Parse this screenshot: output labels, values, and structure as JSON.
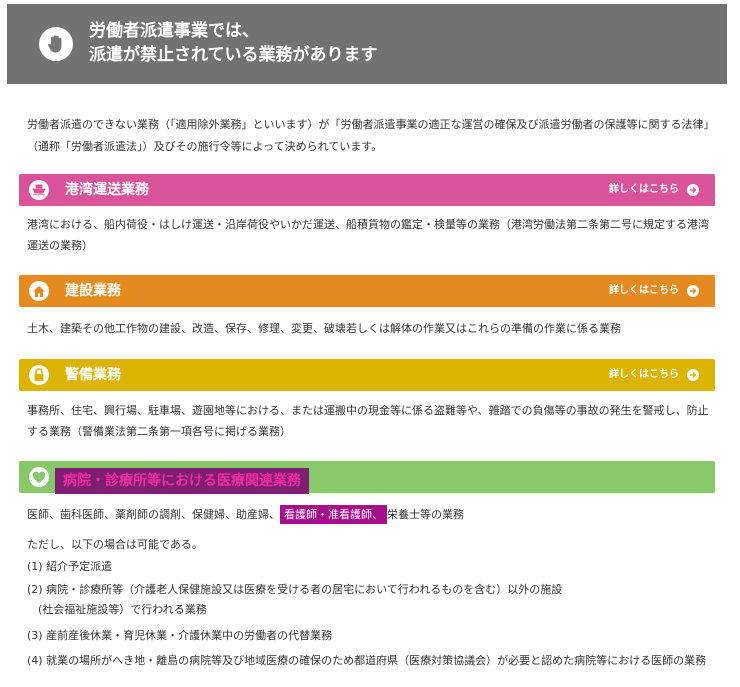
{
  "header": {
    "title_line1": "労働者派遣事業では、",
    "title_line2": "派遣が禁止されている業務があります"
  },
  "intro": "労働者派遣のできない業務（「適用除外業務」といいます）が「労働者派遣事業の適正な運営の確保及び派遣労働者の保護等に関する法律」（通称「労働者派遣法」）及びその施行令等によって決められています。",
  "sections": [
    {
      "title": "港湾運送業務",
      "link": "詳しくはこちら",
      "color": "#d9539b",
      "desc": "港湾における、船内荷役・はしけ運送・沿岸荷役やいかだ運送、船積貨物の鑑定・検量等の業務（港湾労働法第二条第二号に規定する港湾運送の業務）"
    },
    {
      "title": "建設業務",
      "link": "詳しくはこちら",
      "color": "#e58a1f",
      "desc": "土木、建築その他工作物の建設、改造、保存、修理、変更、破壊若しくは解体の作業又はこれらの準備の作業に係る業務"
    },
    {
      "title": "警備業務",
      "link": "詳しくはこちら",
      "color": "#dcb300",
      "desc": "事務所、住宅、興行場、駐車場、遊園地等における、または運搬中の現金等に係る盗難等や、雑踏での負傷等の事故の発生を警戒し、防止する業務（警備業法第二条第一項各号に掲げる業務）"
    },
    {
      "title": "病院・診療所等における医療関連業務",
      "color": "#86c86a",
      "desc_before": "医師、歯科医師、薬剤師の調剤、保健婦、助産婦、",
      "desc_highlight": "看護師・准看護師、",
      "desc_after": "栄養士等の業務"
    }
  ],
  "exceptions": {
    "lead": "ただし、以下の場合は可能である。",
    "items": [
      "(1) 紹介予定派遣",
      "(2) 病院・診療所等（介護老人保健施設又は医療を受ける者の居宅において行われるものを含む）以外の施設",
      "　(社会福祉施設等）で行われる業務",
      "(3) 産前産後休業・育児休業・介護休業中の労働者の代替業務",
      "(4) 就業の場所がへき地・離島の病院等及び地域医療の確保のため都道府県（医療対策協議会）が必要と認めた病院等における医師の業務"
    ]
  }
}
